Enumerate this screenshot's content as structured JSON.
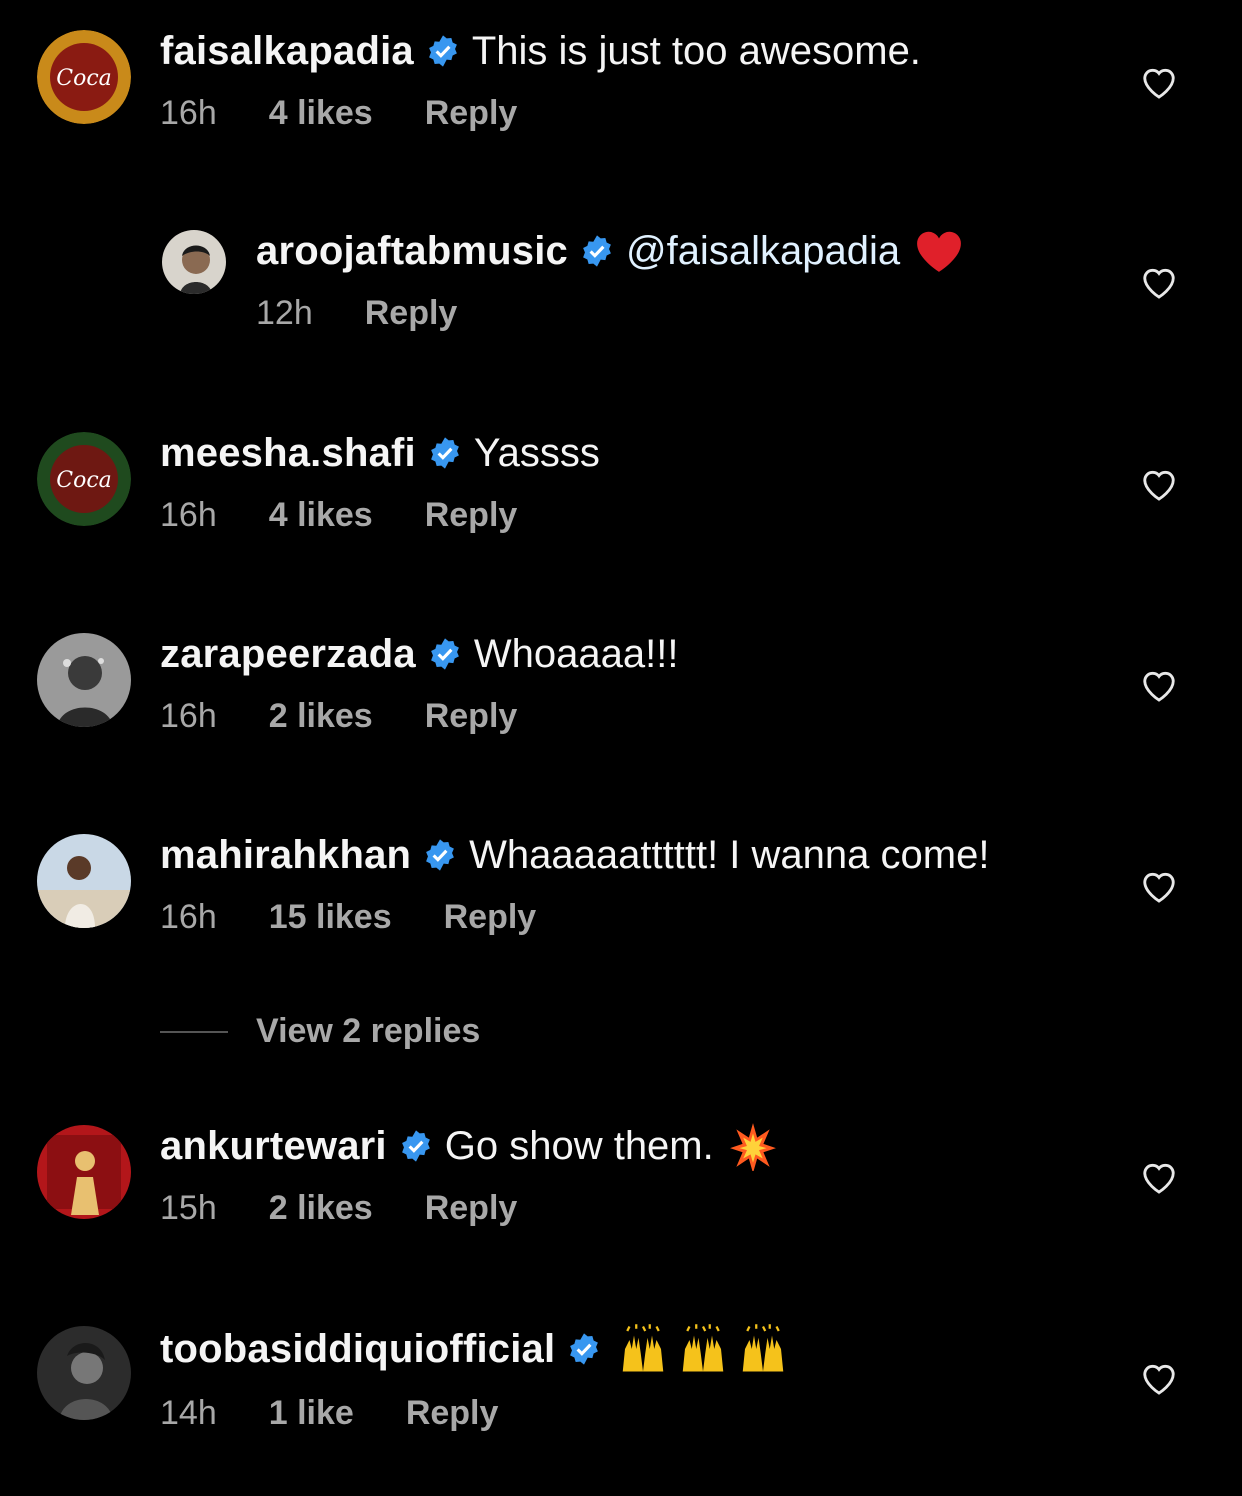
{
  "comments": [
    {
      "username": "faisalkapadia",
      "text": "This is just too awesome.",
      "time": "16h",
      "likes": "4 likes",
      "reply": "Reply"
    },
    {
      "username": "aroojaftabmusic",
      "text": "@faisalkapadia",
      "time": "12h",
      "likes": "",
      "reply": "Reply"
    },
    {
      "username": "meesha.shafi",
      "text": "Yassss",
      "time": "16h",
      "likes": "4 likes",
      "reply": "Reply"
    },
    {
      "username": "zarapeerzada",
      "text": "Whoaaaa!!!",
      "time": "16h",
      "likes": "2 likes",
      "reply": "Reply"
    },
    {
      "username": "mahirahkhan",
      "text": "Whaaaaatttttt! I wanna come!",
      "time": "16h",
      "likes": "15 likes",
      "reply": "Reply"
    },
    {
      "username": "ankurtewari",
      "text": "Go show them.",
      "time": "15h",
      "likes": "2 likes",
      "reply": "Reply"
    },
    {
      "username": "toobasiddiquiofficial",
      "text": "",
      "time": "14h",
      "likes": "1 like",
      "reply": "Reply"
    }
  ],
  "view_replies": "View 2 replies",
  "colors": {
    "background": "#000000",
    "verified": "#3897f0",
    "meta": "#a8a8a8"
  },
  "icons": {
    "verified": "verified-badge-icon",
    "like": "heart-outline-icon"
  }
}
